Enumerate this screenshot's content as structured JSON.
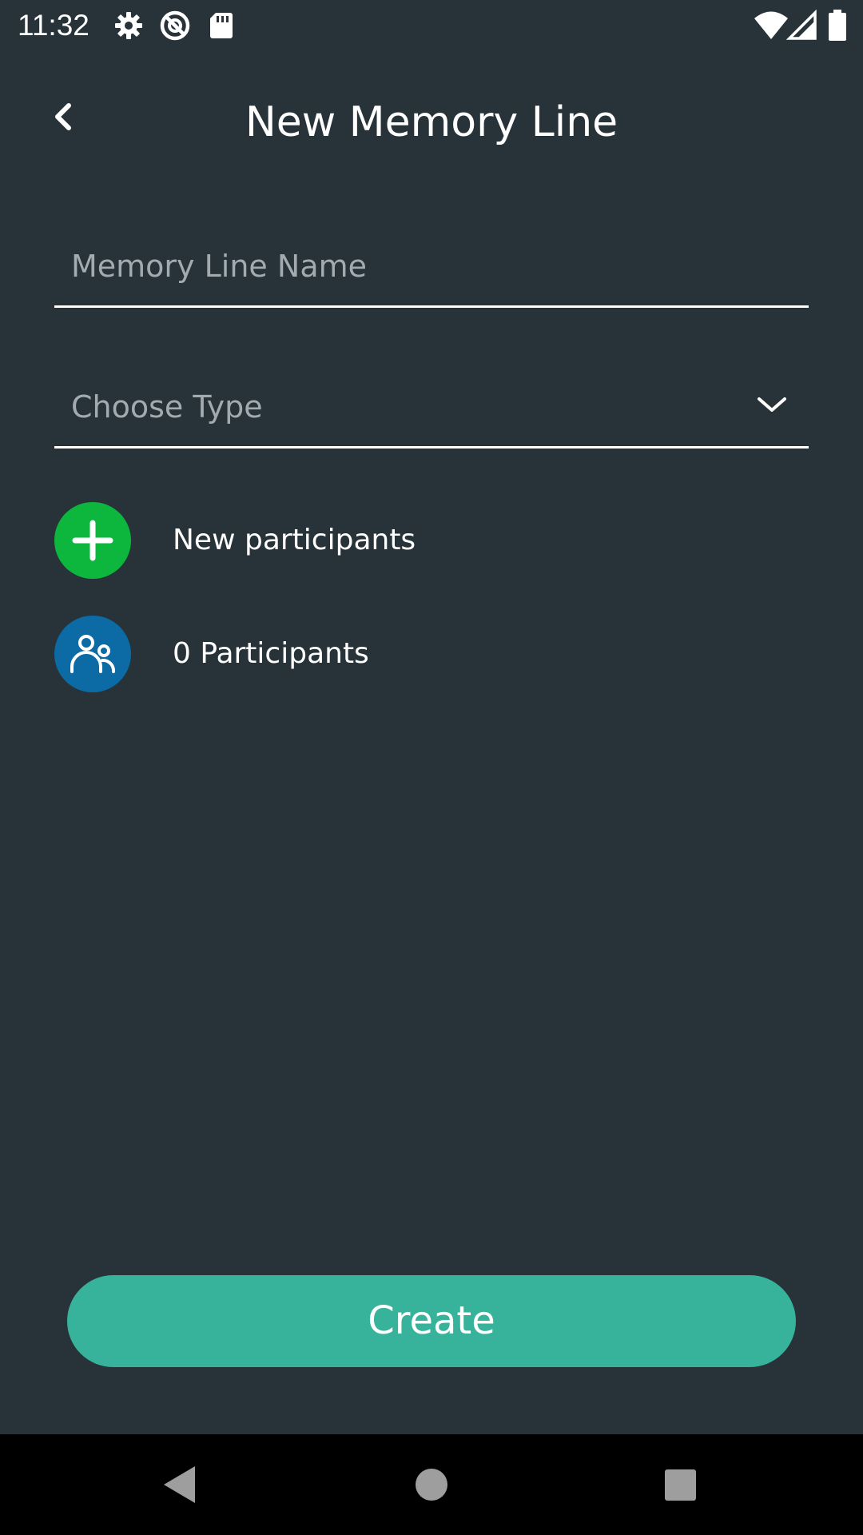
{
  "status_bar": {
    "time": "11:32",
    "icons_left": [
      "gear-icon",
      "do-not-disturb-icon",
      "sd-card-icon"
    ],
    "icons_right": [
      "wifi-icon",
      "signal-icon",
      "battery-icon"
    ]
  },
  "header": {
    "title": "New Memory Line",
    "back_icon": "chevron-left-icon"
  },
  "form": {
    "name_field": {
      "value": "",
      "placeholder": "Memory Line Name"
    },
    "type_field": {
      "placeholder": "Choose Type",
      "icon": "chevron-down-icon"
    }
  },
  "participants": {
    "add_label": "New participants",
    "add_icon": "plus-icon",
    "add_color": "#0db73e",
    "count_label": "0 Participants",
    "count_icon": "people-icon",
    "count_color": "#0c6aa4"
  },
  "actions": {
    "create_label": "Create",
    "create_color": "#38b39b"
  },
  "nav_bar": {
    "buttons": [
      "back-triangle-icon",
      "home-circle-icon",
      "recents-square-icon"
    ]
  },
  "colors": {
    "background": "#273239",
    "text": "#ffffff",
    "placeholder": "#a3abb0"
  }
}
